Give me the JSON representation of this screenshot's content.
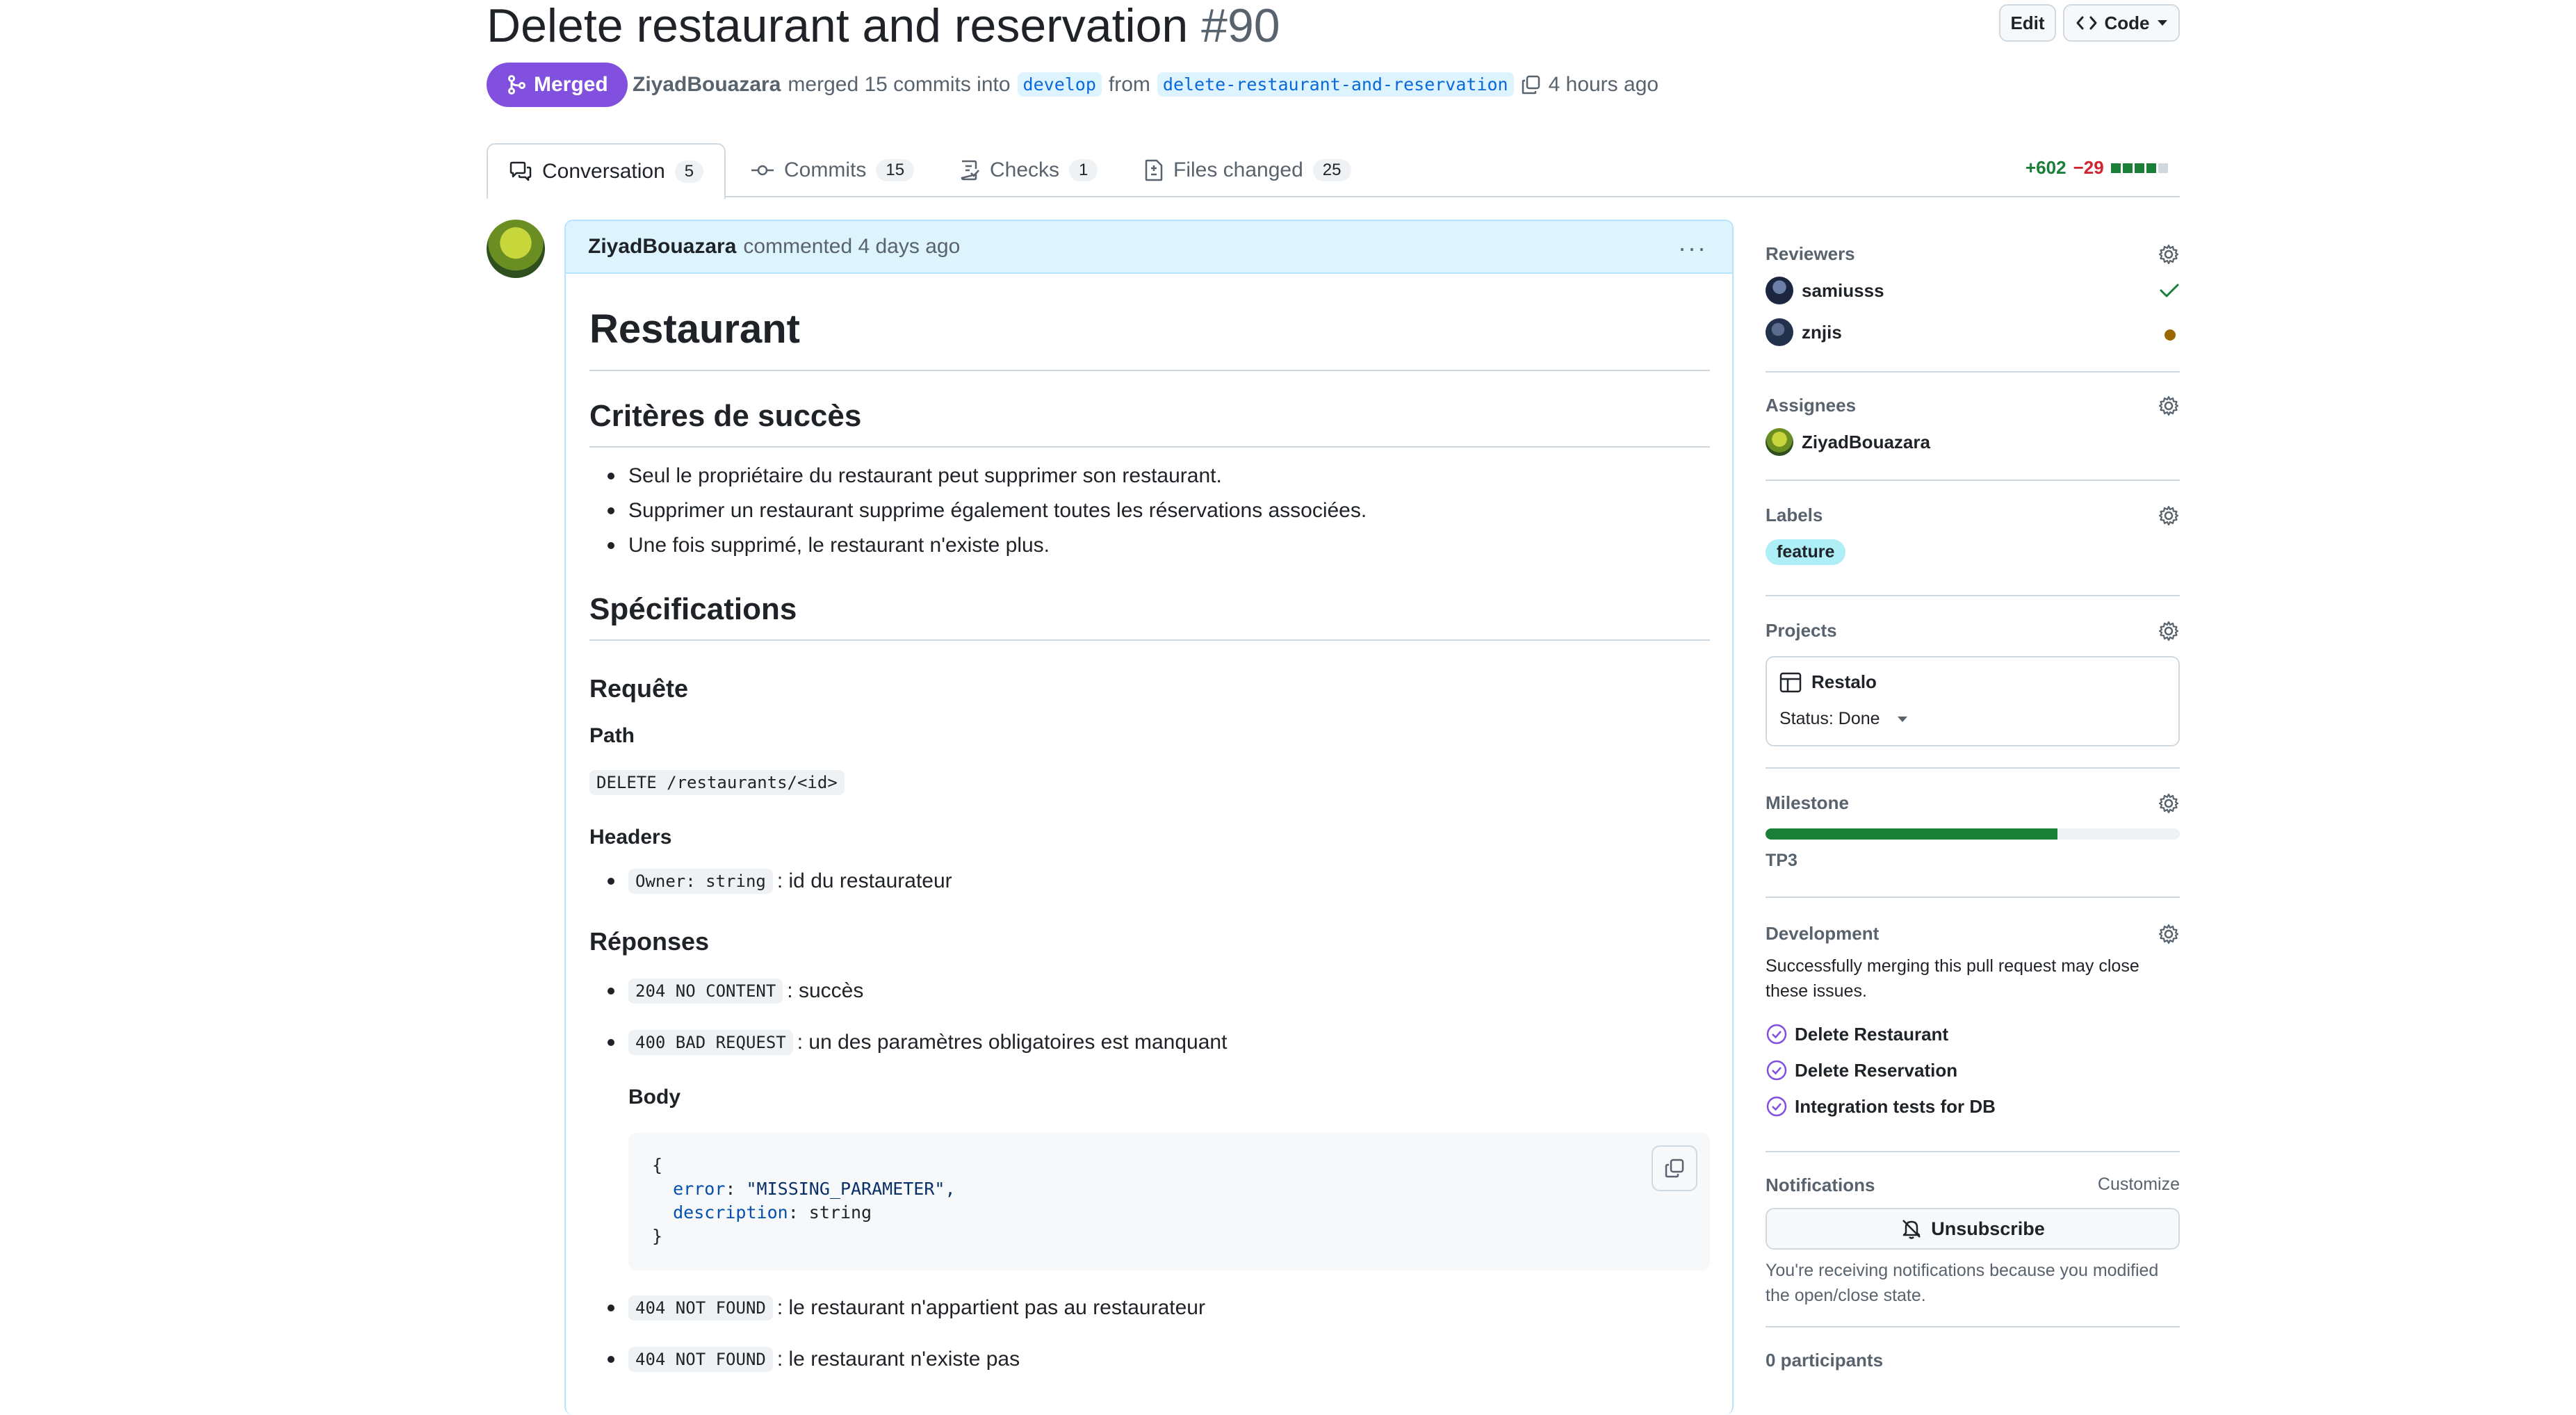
{
  "pr": {
    "title": "Delete restaurant and reservation",
    "number": "#90",
    "status": "Merged",
    "author": "ZiyadBouazara",
    "merge_text": "merged 15 commits into",
    "base_branch": "develop",
    "from_text": "from",
    "head_branch": "delete-restaurant-and-reservation",
    "time_ago": "4 hours ago"
  },
  "header_buttons": {
    "edit": "Edit",
    "code": "Code"
  },
  "tabs": [
    {
      "label": "Conversation",
      "count": "5",
      "icon": "comment-discussion-icon"
    },
    {
      "label": "Commits",
      "count": "15",
      "icon": "git-commit-icon"
    },
    {
      "label": "Checks",
      "count": "1",
      "icon": "checklist-icon"
    },
    {
      "label": "Files changed",
      "count": "25",
      "icon": "file-diff-icon"
    }
  ],
  "diffstat": {
    "additions": "+602",
    "deletions": "−29"
  },
  "comment": {
    "author": "ZiyadBouazara",
    "action": "commented 4 days ago",
    "h1": "Restaurant",
    "criteria_title": "Critères de succès",
    "criteria": [
      "Seul le propriétaire du restaurant peut supprimer son restaurant.",
      "Supprimer un restaurant supprime également toutes les réservations associées.",
      "Une fois supprimé, le restaurant n'existe plus."
    ],
    "spec_title": "Spécifications",
    "request_title": "Requête",
    "path_label": "Path",
    "path_code": "DELETE /restaurants/<id>",
    "headers_label": "Headers",
    "header_code": "Owner: string",
    "header_desc": ": id du restaurateur",
    "responses_title": "Réponses",
    "responses": [
      {
        "code": "204 NO CONTENT",
        "desc": ": succès"
      },
      {
        "code": "400 BAD REQUEST",
        "desc": ": un des paramètres obligatoires est manquant"
      },
      {
        "code": "404 NOT FOUND",
        "desc": ": le restaurant n'appartient pas au restaurateur"
      },
      {
        "code": "404 NOT FOUND",
        "desc": ": le restaurant n'existe pas"
      }
    ],
    "body_label": "Body",
    "code_block": {
      "open": "{",
      "line1_key": "error",
      "line1_val": "\"MISSING_PARAMETER\",",
      "line2_key": "description",
      "line2_val": "string",
      "close": "}"
    }
  },
  "sidebar": {
    "reviewers_title": "Reviewers",
    "reviewers": [
      {
        "name": "samiusss",
        "state": "approved"
      },
      {
        "name": "znjis",
        "state": "pending"
      }
    ],
    "assignees_title": "Assignees",
    "assignee": "ZiyadBouazara",
    "labels_title": "Labels",
    "label": "feature",
    "projects_title": "Projects",
    "project_name": "Restalo",
    "project_status": "Status: Done",
    "milestone_title": "Milestone",
    "milestone_progress": 0.705,
    "milestone_name": "TP3",
    "development_title": "Development",
    "development_text": "Successfully merging this pull request may close these issues.",
    "issues": [
      "Delete Restaurant",
      "Delete Reservation",
      "Integration tests for DB"
    ],
    "notifications_title": "Notifications",
    "customize": "Customize",
    "unsubscribe": "Unsubscribe",
    "notif_reason": "You're receiving notifications because you modified the open/close state.",
    "participants": "0 participants"
  },
  "colors": {
    "merged": "#8250df",
    "accent_blue": "#0969da",
    "success": "#1a7f37",
    "danger": "#d1242f",
    "pending": "#9a6700",
    "label_bg": "#aeeef7"
  }
}
